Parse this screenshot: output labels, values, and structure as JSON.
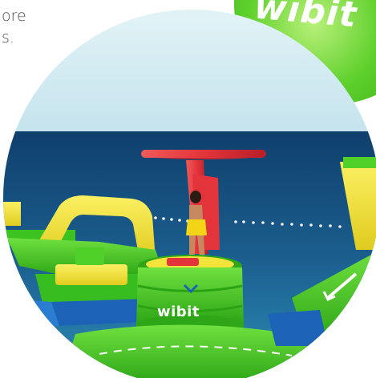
{
  "text": {
    "line1": "ore",
    "line2": "s."
  },
  "brand": {
    "name": "wibit"
  },
  "colors": {
    "sky": "#cfe9ef",
    "sea": "#1b5f8f",
    "green": "#4fd12a",
    "yellow": "#f3e43c",
    "red": "#e3343b",
    "blue": "#1c63b8"
  }
}
